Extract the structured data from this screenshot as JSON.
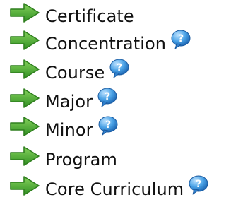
{
  "items": [
    {
      "label": "Certificate",
      "help": false
    },
    {
      "label": "Concentration",
      "help": true
    },
    {
      "label": "Course",
      "help": true
    },
    {
      "label": "Major",
      "help": true
    },
    {
      "label": "Minor",
      "help": true
    },
    {
      "label": "Program",
      "help": false
    },
    {
      "label": "Core Curriculum",
      "help": true
    }
  ],
  "icons": {
    "bullet": "green-arrow-icon",
    "help": "help-bubble-icon"
  },
  "colors": {
    "arrow_green": "#58b23a",
    "arrow_dark": "#2f7f1e",
    "help_blue": "#3f93d8",
    "text": "#111111"
  }
}
